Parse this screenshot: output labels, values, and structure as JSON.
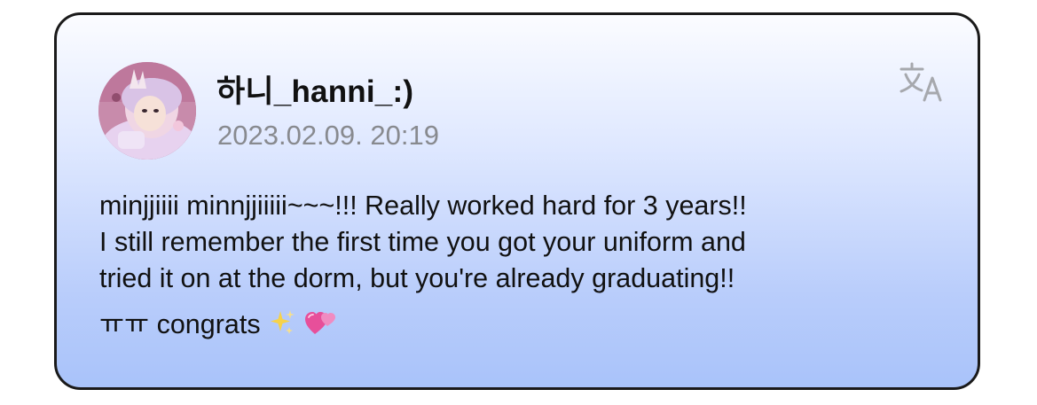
{
  "post": {
    "username": "하니_hanni_:)",
    "timestamp": "2023.02.09. 20:19",
    "body_lines": [
      "minjjiiii minnjjiiiii~~~!!! Really worked hard for 3 years!!",
      "I still remember the first time you got your uniform and",
      "tried it on at the dorm, but you're already graduating!!"
    ],
    "closing_text": "ㅠㅠ congrats",
    "emojis": [
      "sparkles-icon",
      "two-hearts-icon"
    ]
  },
  "icons": {
    "translate": "translate-icon",
    "avatar": "profile-photo"
  },
  "colors": {
    "card_border": "#1a1a1a",
    "gradient_top": "#fbfcff",
    "gradient_bottom": "#a9c3fa",
    "username": "#111111",
    "timestamp": "#888a8f",
    "icon_gray": "#a6a8ad"
  }
}
